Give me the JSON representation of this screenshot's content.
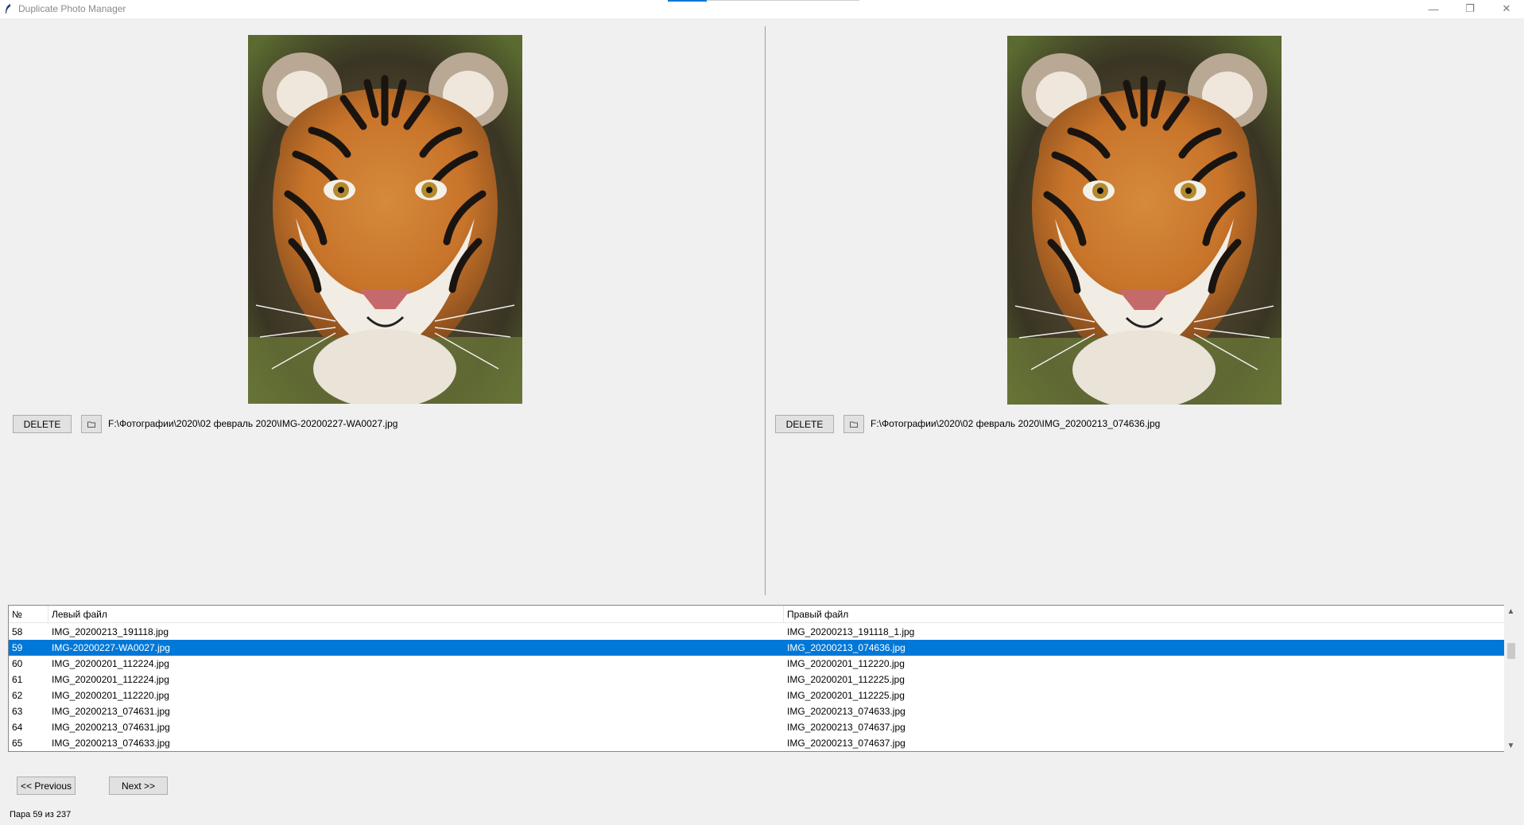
{
  "window": {
    "title": "Duplicate Photo Manager",
    "minimize_glyph": "—",
    "maximize_glyph": "❐",
    "close_glyph": "✕"
  },
  "left_panel": {
    "delete_label": "DELETE",
    "path": "F:\\Фотографии\\2020\\02 февраль 2020\\IMG-20200227-WA0027.jpg",
    "folder_icon": "folder-icon"
  },
  "right_panel": {
    "delete_label": "DELETE",
    "path": "F:\\Фотографии\\2020\\02 февраль 2020\\IMG_20200213_074636.jpg",
    "folder_icon": "folder-icon"
  },
  "table": {
    "columns": [
      "№",
      "Левый файл",
      "Правый файл"
    ],
    "rows": [
      {
        "num": "58",
        "left": "IMG_20200213_191118.jpg",
        "right": "IMG_20200213_191118_1.jpg"
      },
      {
        "num": "59",
        "left": "IMG-20200227-WA0027.jpg",
        "right": "IMG_20200213_074636.jpg"
      },
      {
        "num": "60",
        "left": "IMG_20200201_112224.jpg",
        "right": "IMG_20200201_112220.jpg"
      },
      {
        "num": "61",
        "left": "IMG_20200201_112224.jpg",
        "right": "IMG_20200201_112225.jpg"
      },
      {
        "num": "62",
        "left": "IMG_20200201_112220.jpg",
        "right": "IMG_20200201_112225.jpg"
      },
      {
        "num": "63",
        "left": "IMG_20200213_074631.jpg",
        "right": "IMG_20200213_074633.jpg"
      },
      {
        "num": "64",
        "left": "IMG_20200213_074631.jpg",
        "right": "IMG_20200213_074637.jpg"
      },
      {
        "num": "65",
        "left": "IMG_20200213_074633.jpg",
        "right": "IMG_20200213_074637.jpg"
      }
    ],
    "selected_index": 1,
    "selection_color": "#0078d7"
  },
  "navigation": {
    "prev_label": "<< Previous",
    "next_label": "Next >>"
  },
  "status": {
    "text": "Пара 59 из 237"
  }
}
